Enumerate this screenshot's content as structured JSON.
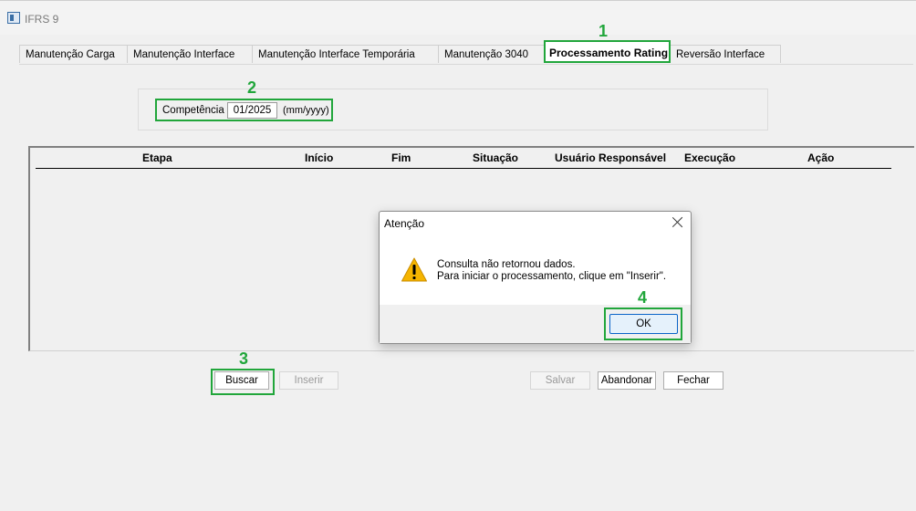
{
  "window": {
    "title": "IFRS 9"
  },
  "tabs": [
    {
      "label": "Manutenção Carga",
      "active": false
    },
    {
      "label": "Manutenção Interface",
      "active": false
    },
    {
      "label": "Manutenção Interface Temporária",
      "active": false
    },
    {
      "label": "Manutenção 3040",
      "active": false
    },
    {
      "label": "Processamento Rating",
      "active": true
    },
    {
      "label": "Reversão Interface",
      "active": false
    }
  ],
  "competencia": {
    "label": "Competência",
    "value": "01/2025",
    "hint": "(mm/yyyy)"
  },
  "grid": {
    "columns": [
      "Etapa",
      "Início",
      "Fim",
      "Situação",
      "Usuário Responsável",
      "Execução",
      "Ação"
    ],
    "rows": []
  },
  "buttons": {
    "buscar": {
      "label": "Buscar",
      "enabled": true
    },
    "inserir": {
      "label": "Inserir",
      "enabled": false
    },
    "salvar": {
      "label": "Salvar",
      "enabled": false
    },
    "abandonar": {
      "label": "Abandonar",
      "enabled": true
    },
    "fechar": {
      "label": "Fechar",
      "enabled": true
    }
  },
  "dialog": {
    "title": "Atenção",
    "icon": "warning-icon",
    "message_line1": "Consulta não retornou dados.",
    "message_line2": "Para iniciar o processamento, clique em \"Inserir\".",
    "ok_label": "OK"
  },
  "annotations": [
    "1",
    "2",
    "3",
    "4"
  ],
  "colors": {
    "highlight": "#21a63b",
    "warning": "#f5b400"
  }
}
